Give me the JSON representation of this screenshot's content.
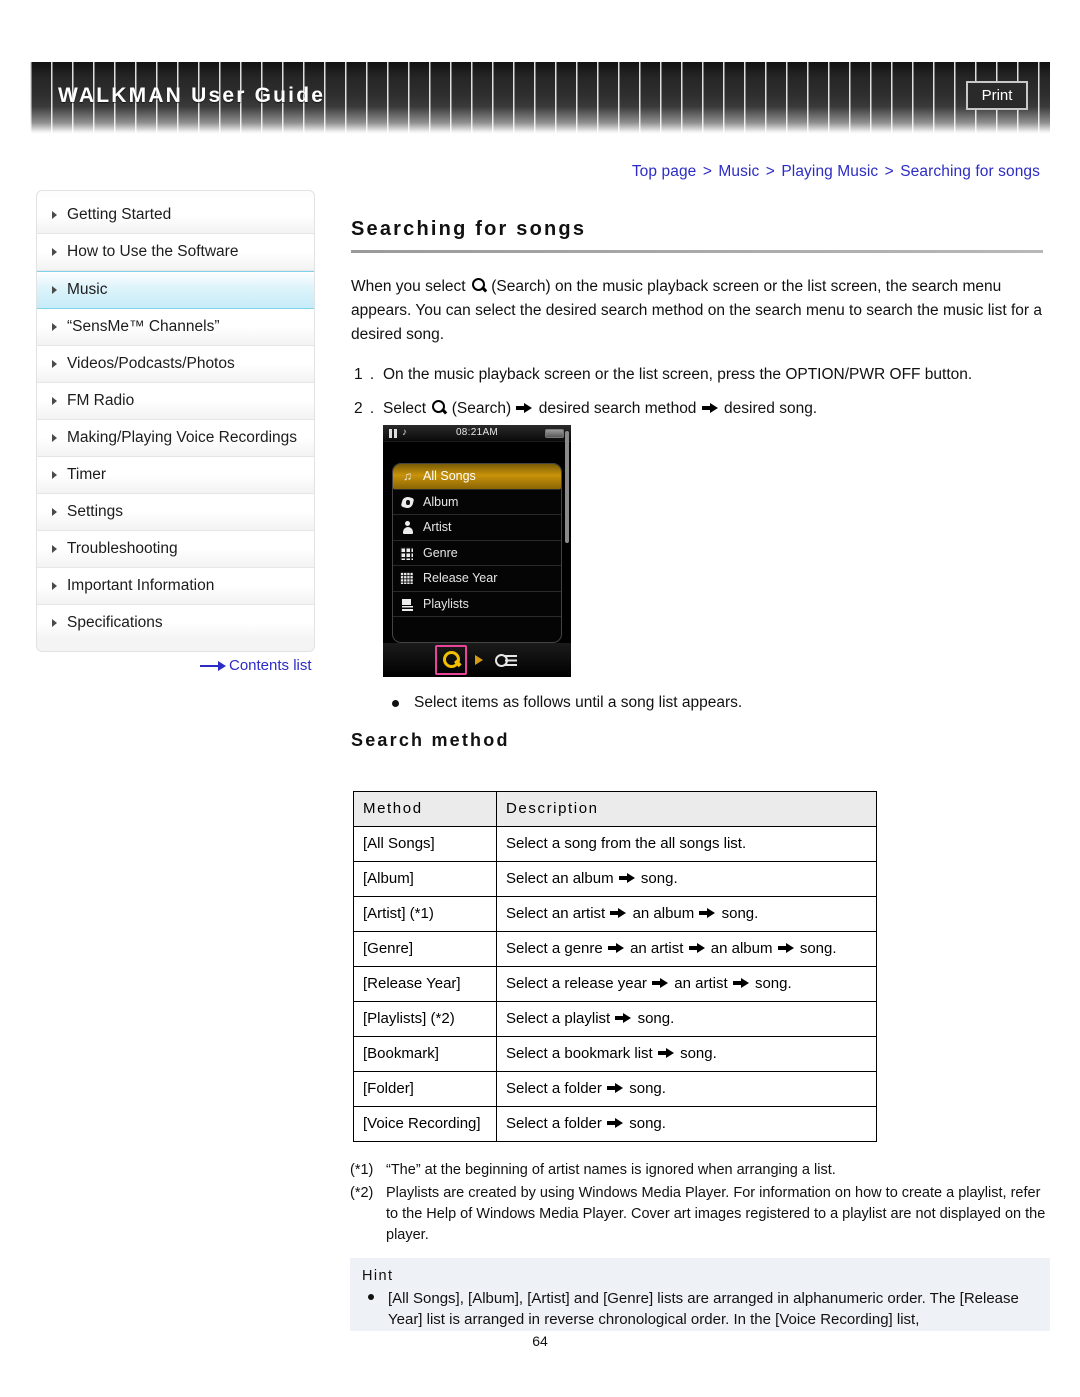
{
  "header": {
    "title": "WALKMAN User Guide",
    "print_label": "Print"
  },
  "breadcrumb": {
    "items": [
      "Top page",
      "Music",
      "Playing Music",
      "Searching for songs"
    ],
    "separator": ">"
  },
  "sidebar": {
    "items": [
      {
        "label": "Getting Started",
        "active": false
      },
      {
        "label": "How to Use the Software",
        "active": false
      },
      {
        "label": "Music",
        "active": true
      },
      {
        "label": "“SensMe™ Channels”",
        "active": false
      },
      {
        "label": "Videos/Podcasts/Photos",
        "active": false
      },
      {
        "label": "FM Radio",
        "active": false
      },
      {
        "label": "Making/Playing Voice Recordings",
        "active": false
      },
      {
        "label": "Timer",
        "active": false
      },
      {
        "label": "Settings",
        "active": false
      },
      {
        "label": "Troubleshooting",
        "active": false
      },
      {
        "label": "Important Information",
        "active": false
      },
      {
        "label": "Specifications",
        "active": false
      }
    ],
    "contents_link": "Contents list"
  },
  "main": {
    "page_title": "Searching for songs",
    "intro_part1": "When you select ",
    "intro_part2": " (Search) on the music playback screen or the list screen, the search menu appears. You can select the desired search method on the search menu to search the music list for a desired song.",
    "step1_num": "1 .",
    "step1_text": "On the music playback screen or the list screen, press the OPTION/PWR OFF button.",
    "step2_num": "2 .",
    "step2_a": "Select ",
    "step2_b": " (Search) ",
    "step2_c": " desired search method ",
    "step2_d": " desired song.",
    "bullet_note": "Select items as follows until a song list appears.",
    "subhead": "Search method"
  },
  "device": {
    "status_time": "08:21AM",
    "menu_items": [
      {
        "label": "All Songs",
        "icon": "music-note-icon",
        "selected": true
      },
      {
        "label": "Album",
        "icon": "disc-icon",
        "selected": false
      },
      {
        "label": "Artist",
        "icon": "person-icon",
        "selected": false
      },
      {
        "label": "Genre",
        "icon": "genre-grid-icon",
        "selected": false
      },
      {
        "label": "Release Year",
        "icon": "calendar-icon",
        "selected": false
      },
      {
        "label": "Playlists",
        "icon": "playlist-icon",
        "selected": false
      }
    ],
    "toolbar": {
      "search_icon": "search-magnifier-icon",
      "arrow_icon": "right-triangle-icon",
      "options_icon": "options-list-icon"
    }
  },
  "table": {
    "headers": [
      "Method",
      "Description"
    ],
    "rows": [
      {
        "method": "[All Songs]",
        "description": "Select a song from the all songs list."
      },
      {
        "method": "[Album]",
        "description_parts": [
          "Select an album",
          "song."
        ]
      },
      {
        "method": "[Artist] (*1)",
        "description_parts": [
          "Select an artist",
          "an album",
          "song."
        ]
      },
      {
        "method": "[Genre]",
        "description_parts": [
          "Select a genre",
          "an artist",
          "an album",
          "song."
        ]
      },
      {
        "method": "[Release Year]",
        "description_parts": [
          "Select a release year",
          "an artist",
          "song."
        ]
      },
      {
        "method": "[Playlists] (*2)",
        "description_parts": [
          "Select a playlist",
          "song."
        ]
      },
      {
        "method": "[Bookmark]",
        "description_parts": [
          "Select a bookmark list",
          "song."
        ]
      },
      {
        "method": "[Folder]",
        "description_parts": [
          "Select a folder",
          "song."
        ]
      },
      {
        "method": "[Voice Recording]",
        "description_parts": [
          "Select a folder",
          "song."
        ]
      }
    ]
  },
  "footnotes": [
    {
      "mark": "(*1)",
      "text": "“The” at the beginning of artist names is ignored when arranging a list."
    },
    {
      "mark": "(*2)",
      "text": "Playlists are created by using Windows Media Player. For information on how to create a playlist, refer to the Help of Windows Media Player. Cover art images registered to a playlist are not displayed on the player."
    }
  ],
  "hint": {
    "title": "Hint",
    "text": "[All Songs], [Album], [Artist] and [Genre] lists are arranged in alphanumeric order. The [Release Year] list is arranged in reverse chronological order. In the [Voice Recording] list,"
  },
  "page_number": "64",
  "colors": {
    "link": "#2c2cc4",
    "sidebar_active": "#c6ecf7",
    "device_selected": "#c9930a",
    "device_highlight_border": "#e8449a",
    "hint_bg": "#eef1f5",
    "table_header_bg": "#ebebeb"
  }
}
